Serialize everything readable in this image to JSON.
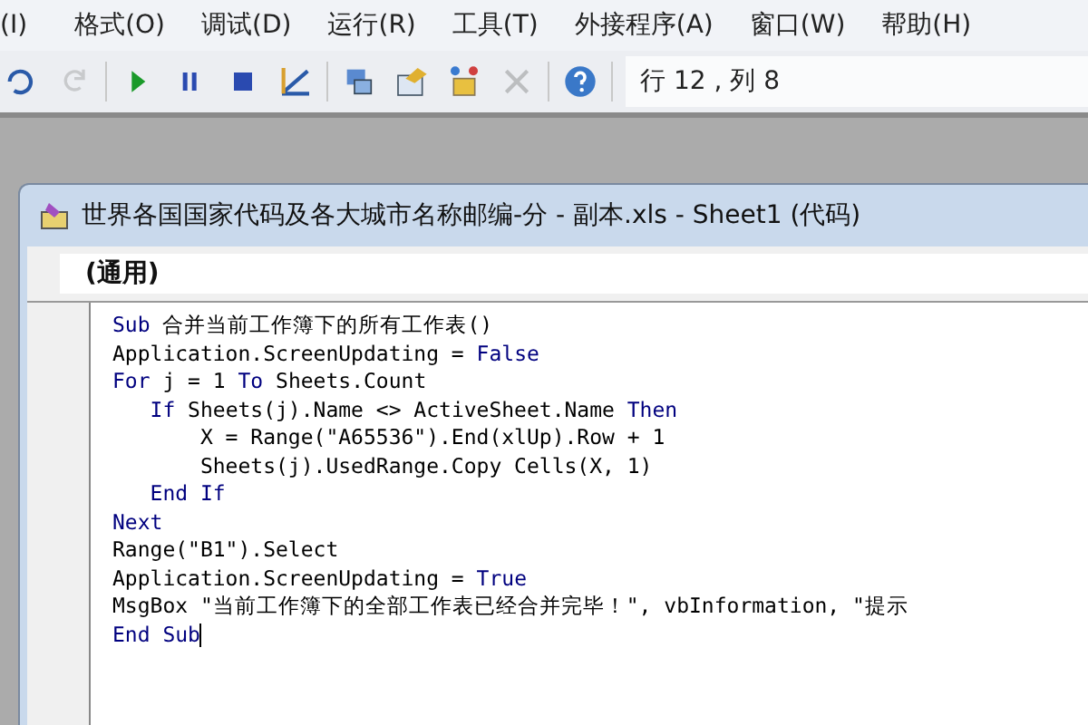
{
  "menu_bar": {
    "items": [
      "(I)",
      "格式(O)",
      "调试(D)",
      "运行(R)",
      "工具(T)",
      "外接程序(A)",
      "窗口(W)",
      "帮助(H)"
    ]
  },
  "toolbar": {
    "buttons": [
      {
        "kind": "undo",
        "disabled": false
      },
      {
        "kind": "redo",
        "disabled": true
      },
      {
        "kind": "run",
        "disabled": false
      },
      {
        "kind": "pause",
        "disabled": false
      },
      {
        "kind": "stop",
        "disabled": false
      },
      {
        "kind": "design",
        "disabled": false
      },
      {
        "kind": "project",
        "disabled": false
      },
      {
        "kind": "properties",
        "disabled": false
      },
      {
        "kind": "browser",
        "disabled": false
      },
      {
        "kind": "toolbox",
        "disabled": true
      },
      {
        "kind": "help",
        "disabled": false
      }
    ],
    "position": "行 12 , 列 8"
  },
  "code_window": {
    "title": "世界各国国家代码及各大城市名称邮编-分 - 副本.xls - Sheet1 (代码)",
    "object_box": "(通用)",
    "lines": [
      [
        {
          "t": "Sub",
          "kind": "keyword"
        },
        {
          "t": " 合并当前工作簿下的所有工作表()",
          "kind": "plain"
        }
      ],
      [
        {
          "t": "Application.ScreenUpdating = ",
          "kind": "plain"
        },
        {
          "t": "False",
          "kind": "keyword"
        }
      ],
      [
        {
          "t": "For",
          "kind": "keyword"
        },
        {
          "t": " j = 1 ",
          "kind": "plain"
        },
        {
          "t": "To",
          "kind": "keyword"
        },
        {
          "t": " Sheets.Count",
          "kind": "plain"
        }
      ],
      [
        {
          "t": "   If",
          "kind": "keyword"
        },
        {
          "t": " Sheets(j).Name <> ActiveSheet.Name ",
          "kind": "plain"
        },
        {
          "t": "Then",
          "kind": "keyword"
        }
      ],
      [
        {
          "t": "       X = Range(\"A65536\").End(xlUp).Row + 1",
          "kind": "plain"
        }
      ],
      [
        {
          "t": "       Sheets(j).UsedRange.Copy Cells(X, 1)",
          "kind": "plain"
        }
      ],
      [
        {
          "t": "   End If",
          "kind": "keyword"
        }
      ],
      [
        {
          "t": "Next",
          "kind": "keyword"
        }
      ],
      [
        {
          "t": "Range(\"B1\").Select",
          "kind": "plain"
        }
      ],
      [
        {
          "t": "Application.ScreenUpdating = ",
          "kind": "plain"
        },
        {
          "t": "True",
          "kind": "keyword"
        }
      ],
      [
        {
          "t": "MsgBox \"当前工作簿下的全部工作表已经合并完毕！\", vbInformation, \"提示",
          "kind": "plain"
        }
      ],
      [
        {
          "t": "End Sub",
          "kind": "keyword"
        }
      ]
    ],
    "cursor_after_last_line": true
  }
}
